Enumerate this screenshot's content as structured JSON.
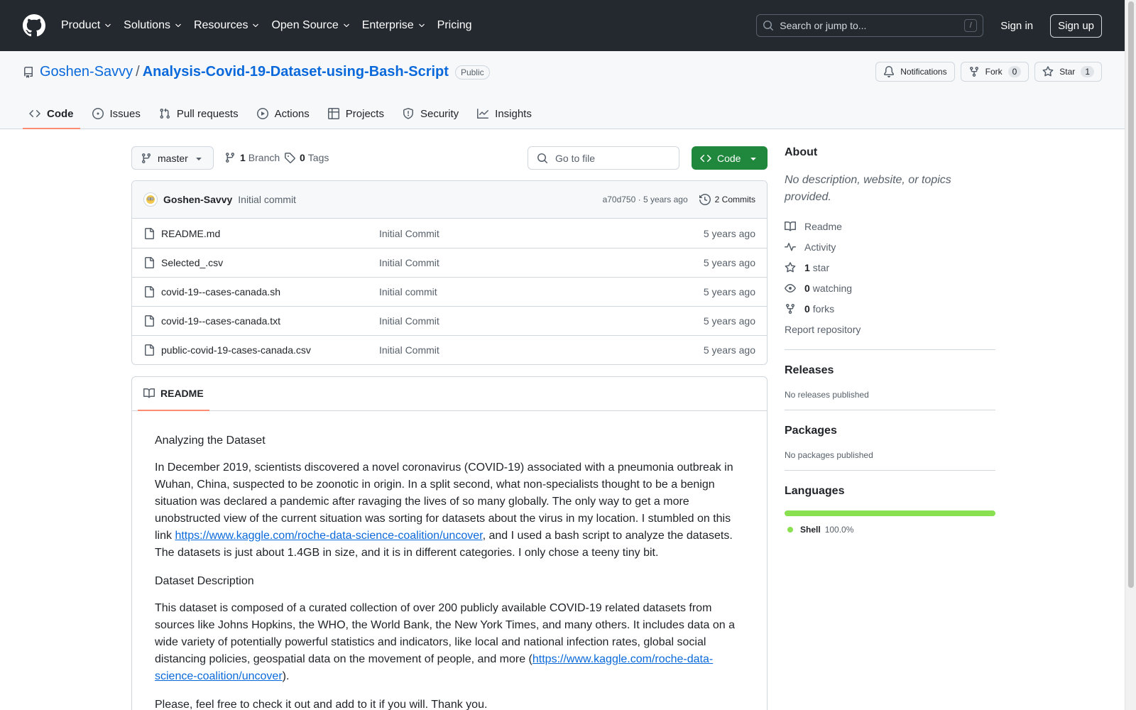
{
  "header": {
    "nav": [
      {
        "label": "Product",
        "has_menu": true
      },
      {
        "label": "Solutions",
        "has_menu": true
      },
      {
        "label": "Resources",
        "has_menu": true
      },
      {
        "label": "Open Source",
        "has_menu": true
      },
      {
        "label": "Enterprise",
        "has_menu": true
      },
      {
        "label": "Pricing",
        "has_menu": false
      }
    ],
    "search_placeholder": "Search or jump to...",
    "search_shortcut": "/",
    "sign_in": "Sign in",
    "sign_up": "Sign up"
  },
  "repo": {
    "owner": "Goshen-Savvy",
    "separator": "/",
    "name": "Analysis-Covid-19-Dataset-using-Bash-Script",
    "visibility": "Public",
    "notifications_label": "Notifications",
    "fork_label": "Fork",
    "fork_count": "0",
    "star_label": "Star",
    "star_count": "1"
  },
  "tabs": [
    {
      "label": "Code",
      "icon": "code-icon",
      "active": true
    },
    {
      "label": "Issues",
      "icon": "issue-icon",
      "active": false
    },
    {
      "label": "Pull requests",
      "icon": "pull-request-icon",
      "active": false
    },
    {
      "label": "Actions",
      "icon": "play-icon",
      "active": false
    },
    {
      "label": "Projects",
      "icon": "table-icon",
      "active": false
    },
    {
      "label": "Security",
      "icon": "shield-icon",
      "active": false
    },
    {
      "label": "Insights",
      "icon": "graph-icon",
      "active": false
    }
  ],
  "toolbar": {
    "branch": "master",
    "branch_count": "1",
    "branch_label": "Branch",
    "tag_count": "0",
    "tag_label": "Tags",
    "goto_placeholder": "Go to file",
    "code_button": "Code"
  },
  "latest_commit": {
    "author": "Goshen-Savvy",
    "message": "Initial commit",
    "sha_time": "a70d750 · 5 years ago",
    "commits_label": "2 Commits"
  },
  "files": [
    {
      "name": "README.md",
      "message": "Initial Commit",
      "time": "5 years ago"
    },
    {
      "name": "Selected_.csv",
      "message": "Initial Commit",
      "time": "5 years ago"
    },
    {
      "name": "covid-19--cases-canada.sh",
      "message": "Initial commit",
      "time": "5 years ago"
    },
    {
      "name": "covid-19--cases-canada.txt",
      "message": "Initial Commit",
      "time": "5 years ago"
    },
    {
      "name": "public-covid-19-cases-canada.csv",
      "message": "Initial Commit",
      "time": "5 years ago"
    }
  ],
  "readme": {
    "tab_label": "README",
    "heading1": "Analyzing the Dataset",
    "para1_before": "In December 2019, scientists discovered a novel coronavirus (COVID-19) associated with a pneumonia outbreak in Wuhan, China, suspected to be zoonotic in origin. In a split second, what non-specialists thought to be a benign situation was declared a pandemic after ravaging the lives of so many globally. The only way to get a more unobstructed view of the current situation was sorting for datasets about the virus in my location. I stumbled on this link ",
    "para1_link": "https://www.kaggle.com/roche-data-science-coalition/uncover",
    "para1_after": ", and I used a bash script to analyze the datasets. The datasets is just about 1.4GB in size, and it is in different categories. I only chose a teeny tiny bit.",
    "heading2": "Dataset Description",
    "para2_before": "This dataset is composed of a curated collection of over 200 publicly available COVID-19 related datasets from sources like Johns Hopkins, the WHO, the World Bank, the New York Times, and many others. It includes data on a wide variety of potentially powerful statistics and indicators, like local and national infection rates, global social distancing policies, geospatial data on the movement of people, and more (",
    "para2_link": "https://www.kaggle.com/roche-data-science-coalition/uncover",
    "para2_after": ").",
    "para3": "Please, feel free to check it out and add to it if you will. Thank you."
  },
  "sidebar": {
    "about_title": "About",
    "about_desc": "No description, website, or topics provided.",
    "links": [
      {
        "icon": "book-icon",
        "count": "",
        "label": "Readme"
      },
      {
        "icon": "pulse-icon",
        "count": "",
        "label": "Activity"
      },
      {
        "icon": "star-icon",
        "count": "1",
        "label": "star"
      },
      {
        "icon": "eye-icon",
        "count": "0",
        "label": "watching"
      },
      {
        "icon": "fork-icon",
        "count": "0",
        "label": "forks"
      }
    ],
    "report": "Report repository",
    "releases_title": "Releases",
    "releases_text": "No releases published",
    "packages_title": "Packages",
    "packages_text": "No packages published",
    "languages_title": "Languages",
    "languages": [
      {
        "name": "Shell",
        "percent": "100.0%",
        "color": "#89e051"
      }
    ]
  },
  "colors": {
    "header_bg": "#24292f",
    "link": "#0969da",
    "primary_button": "#1f883d",
    "tab_underline": "#fd8c73",
    "shell": "#89e051"
  }
}
